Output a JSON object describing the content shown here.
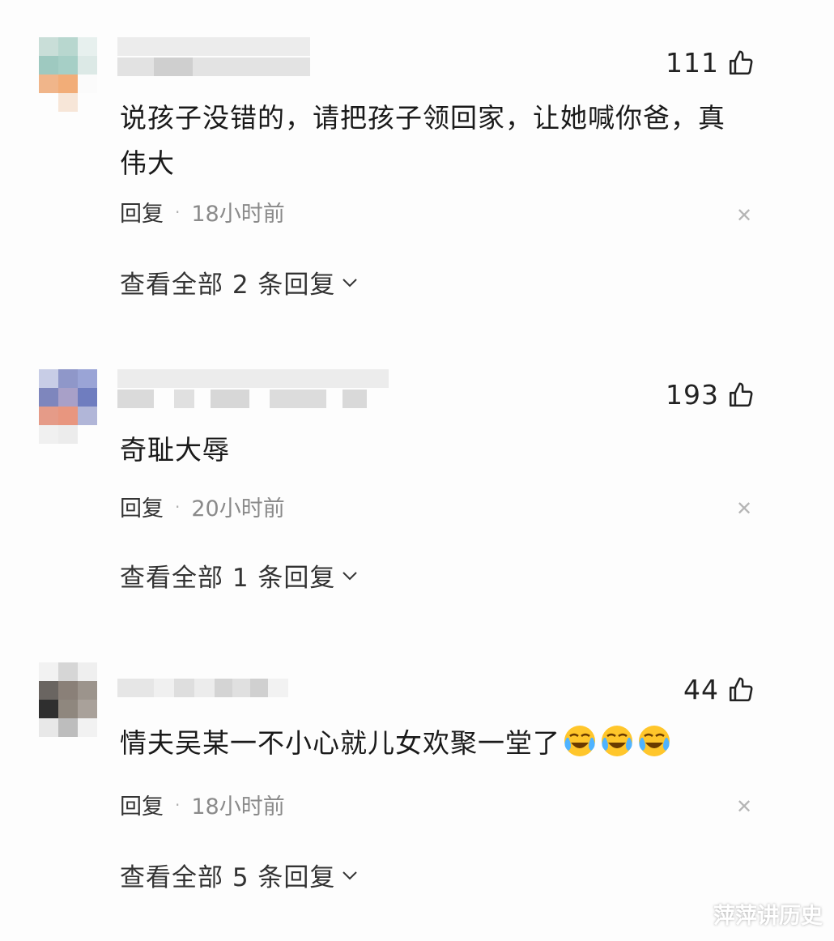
{
  "comments": [
    {
      "likes": "111",
      "text": "说孩子没错的，请把孩子领回家，让她喊你爸，真伟大",
      "reply_label": "回复",
      "separator": "·",
      "time": "18小时前",
      "view_replies": "查看全部 2 条回复"
    },
    {
      "likes": "193",
      "text": "奇耻大辱",
      "reply_label": "回复",
      "separator": "·",
      "time": "20小时前",
      "view_replies": "查看全部 1 条回复"
    },
    {
      "likes": "44",
      "text": "情夫吴某一不小心就儿女欢聚一堂了",
      "reply_label": "回复",
      "separator": "·",
      "time": "18小时前",
      "view_replies": "查看全部 5 条回复",
      "emojis": [
        "crying-laughing-emoji",
        "crying-laughing-emoji",
        "crying-laughing-emoji"
      ]
    }
  ],
  "icons": {
    "like": "thumbs-up-icon",
    "close": "close-icon",
    "expand": "chevron-down-icon"
  },
  "watermark": "萍萍讲历史"
}
